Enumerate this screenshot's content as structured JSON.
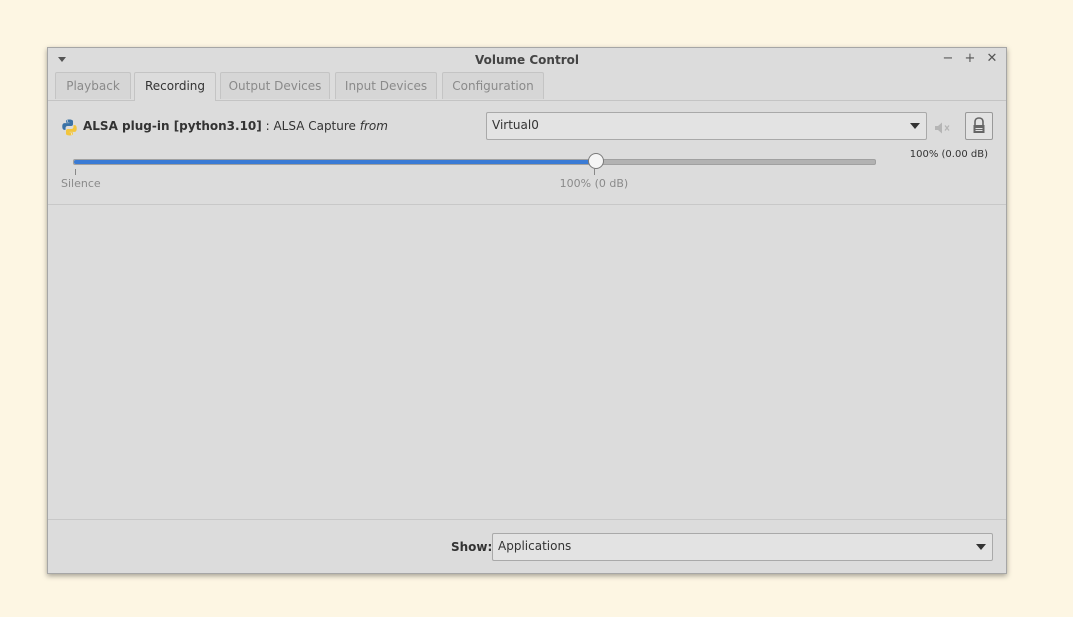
{
  "window": {
    "title": "Volume Control",
    "controls": {
      "minimize": "−",
      "maximize": "+",
      "close": "✕"
    }
  },
  "tabs": [
    {
      "label": "Playback",
      "active": false
    },
    {
      "label": "Recording",
      "active": true
    },
    {
      "label": "Output Devices",
      "active": false
    },
    {
      "label": "Input Devices",
      "active": false
    },
    {
      "label": "Configuration",
      "active": false
    }
  ],
  "stream": {
    "icon": "python-icon",
    "app_name": "ALSA plug-in [python3.10]",
    "separator": ":",
    "stream_name": "ALSA Capture",
    "from_word": "from",
    "source_selected": "Virtual0",
    "volume_readout": "100% (0.00 dB)",
    "volume_fraction": 0.65,
    "tick_labels": {
      "silence": "Silence",
      "norm": "100% (0 dB)"
    },
    "mute_icon": "speaker-muted-icon",
    "lock_icon": "lock-icon"
  },
  "footer": {
    "show_label": "Show:",
    "show_selected": "Applications"
  },
  "colors": {
    "accent": "#3a7bd5",
    "background": "#fdf6e3",
    "window": "#dcdcdc"
  }
}
